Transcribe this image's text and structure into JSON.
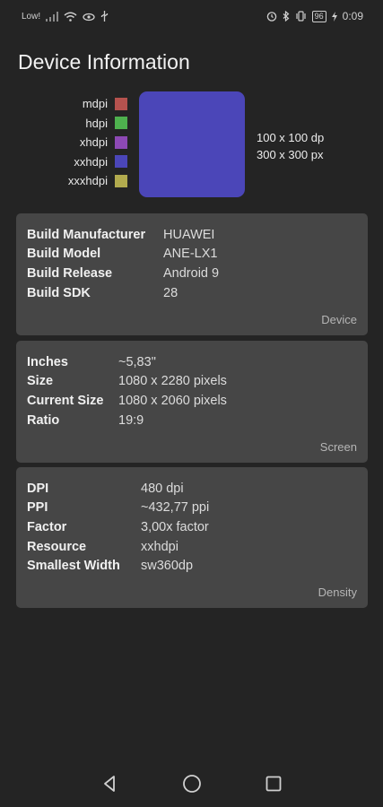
{
  "status_bar": {
    "carrier": "Low!",
    "battery": "96",
    "time": "0:09"
  },
  "title": "Device Information",
  "density_legend": [
    {
      "label": "mdpi",
      "color": "#b5524e"
    },
    {
      "label": "hdpi",
      "color": "#4eb14e"
    },
    {
      "label": "xhdpi",
      "color": "#8d49b4"
    },
    {
      "label": "xxhdpi",
      "color": "#4b46b8"
    },
    {
      "label": "xxxhdpi",
      "color": "#b2ab4e"
    }
  ],
  "preview": {
    "color": "#4b46b8",
    "size_dp": "100 x 100 dp",
    "size_px": "300 x 300 px"
  },
  "device_card": {
    "footer": "Device",
    "rows": [
      {
        "key": "Build Manufacturer",
        "value": "HUAWEI"
      },
      {
        "key": "Build Model",
        "value": "ANE-LX1"
      },
      {
        "key": "Build Release",
        "value": "Android 9"
      },
      {
        "key": "Build SDK",
        "value": "28"
      }
    ]
  },
  "screen_card": {
    "footer": "Screen",
    "rows": [
      {
        "key": "Inches",
        "value": "~5,83\""
      },
      {
        "key": "Size",
        "value": "1080 x 2280 pixels"
      },
      {
        "key": "Current Size",
        "value": "1080 x 2060 pixels"
      },
      {
        "key": "Ratio",
        "value": "19:9"
      }
    ]
  },
  "density_card": {
    "footer": "Density",
    "rows": [
      {
        "key": "DPI",
        "value": "480 dpi"
      },
      {
        "key": "PPI",
        "value": "~432,77 ppi"
      },
      {
        "key": "Factor",
        "value": "3,00x factor"
      },
      {
        "key": "Resource",
        "value": "xxhdpi"
      },
      {
        "key": "Smallest Width",
        "value": "sw360dp"
      }
    ]
  },
  "nav_bar": {
    "icons": [
      "back-icon",
      "home-icon",
      "recents-icon"
    ]
  }
}
